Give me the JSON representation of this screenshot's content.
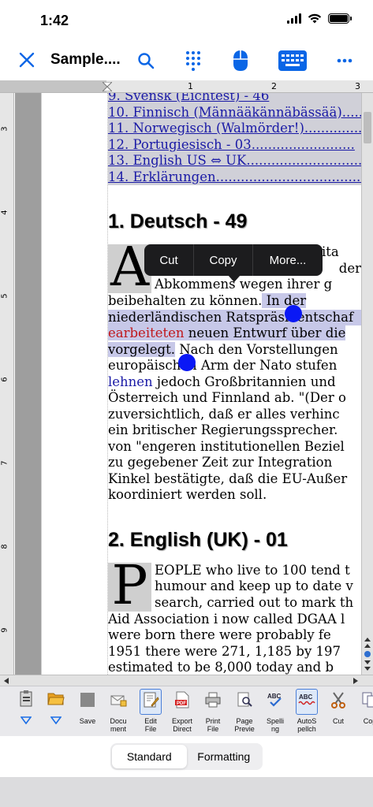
{
  "status": {
    "time": "1:42"
  },
  "nav": {
    "title": "Sample....",
    "accent": "#0a66e6"
  },
  "ruler": {
    "top_ticks": [
      "1",
      "2",
      "3"
    ],
    "left_ticks": [
      "3",
      "4",
      "5",
      "6",
      "7",
      "8",
      "9"
    ]
  },
  "toc": [
    "9. Svensk (Eichtest) - 46",
    "10. Finnisch (Männääkännäbässää)........",
    "11. Norwegisch (Walmörder!)...............",
    "12. Portugiesisch - 03.........................",
    "13. English US ⇔ UK..............................",
    "14. Erklärungen....................................."
  ],
  "section1": {
    "heading": "1. Deutsch - 49",
    "dropcap": "A",
    "lines_cap": [
      "bgeordneten Abt. Großbrita",
      "",
      "Abkommens wegen ihrer g"
    ],
    "line_b1": "beibehalten zu können.",
    "line_b1_sel": " In der ",
    "line_c1_sel": "niederländischen Ratspräsidentschaf",
    "line_d1_red": "earbeiteten",
    "line_d1_sel": " neuen Entwurf über die",
    "line_e1_sel": "vorgelegt.",
    "line_e1": " Nach den Vorstellungen",
    "line_f1": "europäischen Arm der Nato stufen",
    "line_g1_blue": "lehnen",
    "line_g1": " jedoch Großbritannien und",
    "lines_rest": [
      "Österreich und Finnland ab. \"(Der o",
      "zuversichtlich, daß er alles verhinc",
      "ein britischer Regierungssprecher.",
      "von \"engeren institutionellen Beziel",
      "zu gegebener Zeit zur Integration",
      "Kinkel bestätigte, daß die EU-Außer",
      "koordiniert werden soll."
    ],
    "der": "der"
  },
  "section2": {
    "heading": "2. English (UK) - 01",
    "dropcap": "P",
    "lines_cap": [
      "EOPLE who live to 100 tend t",
      "humour and keep up to date v",
      "search, carried out to mark th"
    ],
    "lines_rest": [
      "Aid Association i now called DGAA l",
      "were born there were probably fe",
      "1951 there were 271, 1,185 by 197",
      "estimated to be 8,000 today and b"
    ]
  },
  "context_menu": {
    "items": [
      "Cut",
      "Copy",
      "More..."
    ]
  },
  "toolbar": {
    "items": [
      {
        "label": "",
        "icon": "clipboard-icon"
      },
      {
        "label": "",
        "icon": "folder-icon"
      },
      {
        "label": "Save",
        "icon": "save-icon"
      },
      {
        "label": "Docu\nment",
        "icon": "document-mail-icon"
      },
      {
        "label": "Edit\nFile",
        "icon": "edit-file-icon"
      },
      {
        "label": "Export\nDirect",
        "icon": "pdf-icon"
      },
      {
        "label": "Print\nFile",
        "icon": "printer-icon"
      },
      {
        "label": "Page\nPrevie",
        "icon": "page-preview-icon"
      },
      {
        "label": "Spelli\nng",
        "icon": "spelling-icon"
      },
      {
        "label": "AutoS\npellch",
        "icon": "autospell-icon"
      },
      {
        "label": "Cut",
        "icon": "scissors-icon"
      },
      {
        "label": "Cop",
        "icon": "copy-icon"
      }
    ]
  },
  "segmented": {
    "options": [
      "Standard",
      "Formatting"
    ],
    "selected": "Standard"
  }
}
